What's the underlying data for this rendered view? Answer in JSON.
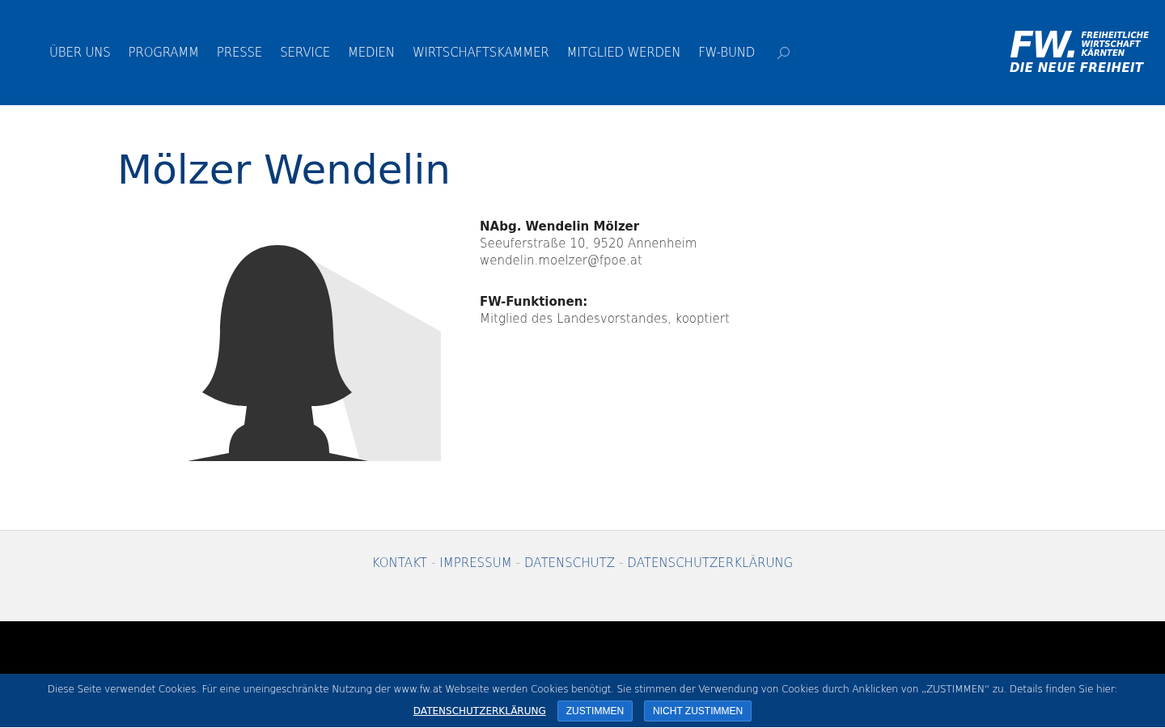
{
  "nav": {
    "items": [
      {
        "label": "ÜBER UNS"
      },
      {
        "label": "PROGRAMM"
      },
      {
        "label": "PRESSE"
      },
      {
        "label": "SERVICE"
      },
      {
        "label": "MEDIEN"
      },
      {
        "label": "WIRTSCHAFTSKAMMER"
      },
      {
        "label": "MITGLIED WERDEN"
      },
      {
        "label": "FW-BUND"
      }
    ]
  },
  "logo": {
    "mark": "FW.",
    "lines": [
      "FREIHEITLICHE",
      "WIRTSCHAFT",
      "KÄRNTEN"
    ],
    "slogan": "DIE NEUE FREIHEIT"
  },
  "page": {
    "title": "Mölzer Wendelin",
    "contact": {
      "name": "NAbg. Wendelin Mölzer",
      "address": "Seeuferstraße 10, 9520 Annenheim",
      "email": "wendelin.moelzer@fpoe.at"
    },
    "functions": {
      "heading": "FW-Funktionen:",
      "text": "Mitglied des Landesvorstandes, kooptiert"
    }
  },
  "footer": {
    "items": [
      {
        "kind": "link",
        "text": "KONTAKT"
      },
      {
        "kind": "separator",
        "text": "-"
      },
      {
        "kind": "link",
        "text": "IMPRESSUM"
      },
      {
        "kind": "separator",
        "text": "-"
      },
      {
        "kind": "link",
        "text": "DATENSCHUTZ"
      },
      {
        "kind": "separator",
        "text": "-"
      },
      {
        "kind": "link",
        "text": "DATENSCHUTZERKLÄRUNG"
      }
    ]
  },
  "cookie_bar": {
    "message": "Diese Seite verwendet Cookies. Für eine uneingeschränkte Nutzung der www.fw.at Webseite werden Cookies benötigt. Sie stimmen der Verwendung von Cookies durch Anklicken von „ZUSTIMMEN“ zu. Details finden Sie hier:",
    "link": "DATENSCHUTZERKLÄRUNG",
    "buttons": [
      "ZUSTIMMEN",
      "NICHT ZUSTIMMEN"
    ]
  }
}
